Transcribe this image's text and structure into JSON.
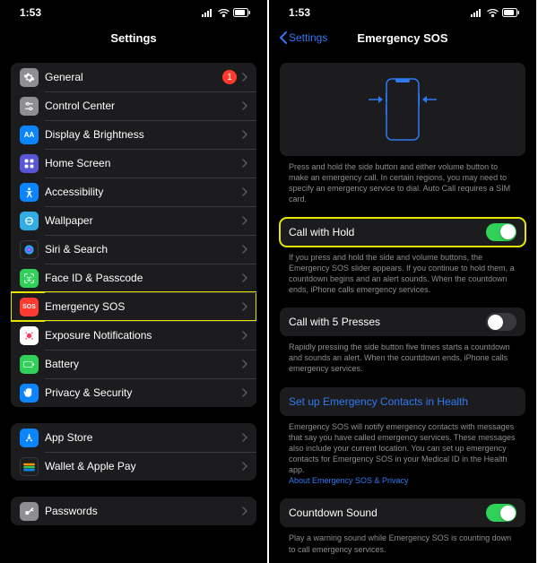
{
  "status": {
    "time": "1:53"
  },
  "left": {
    "title": "Settings",
    "general_badge": "1",
    "items": {
      "general": "General",
      "control_center": "Control Center",
      "display": "Display & Brightness",
      "home": "Home Screen",
      "accessibility": "Accessibility",
      "wallpaper": "Wallpaper",
      "siri": "Siri & Search",
      "faceid": "Face ID & Passcode",
      "sos": "Emergency SOS",
      "exposure": "Exposure Notifications",
      "battery": "Battery",
      "privacy": "Privacy & Security",
      "appstore": "App Store",
      "wallet": "Wallet & Apple Pay",
      "passwords": "Passwords"
    }
  },
  "right": {
    "back": "Settings",
    "title": "Emergency SOS",
    "illus_footer": "Press and hold the side button and either volume button to make an emergency call. In certain regions, you may need to specify an emergency service to dial. Auto Call requires a SIM card.",
    "call_hold": "Call with Hold",
    "call_hold_footer": "If you press and hold the side and volume buttons, the Emergency SOS slider appears. If you continue to hold them, a countdown begins and an alert sounds. When the countdown ends, iPhone calls emergency services.",
    "call_presses": "Call with 5 Presses",
    "call_presses_footer": "Rapidly pressing the side button five times starts a countdown and sounds an alert. When the countdown ends, iPhone calls emergency services.",
    "setup_link": "Set up Emergency Contacts in Health",
    "contacts_footer": "Emergency SOS will notify emergency contacts with messages that say you have called emergency services. These messages also include your current location. You can set up emergency contacts for Emergency SOS in your Medical ID in the Health app.",
    "about_link": "About Emergency SOS & Privacy",
    "countdown": "Countdown Sound",
    "countdown_footer": "Play a warning sound while Emergency SOS is counting down to call emergency services."
  }
}
